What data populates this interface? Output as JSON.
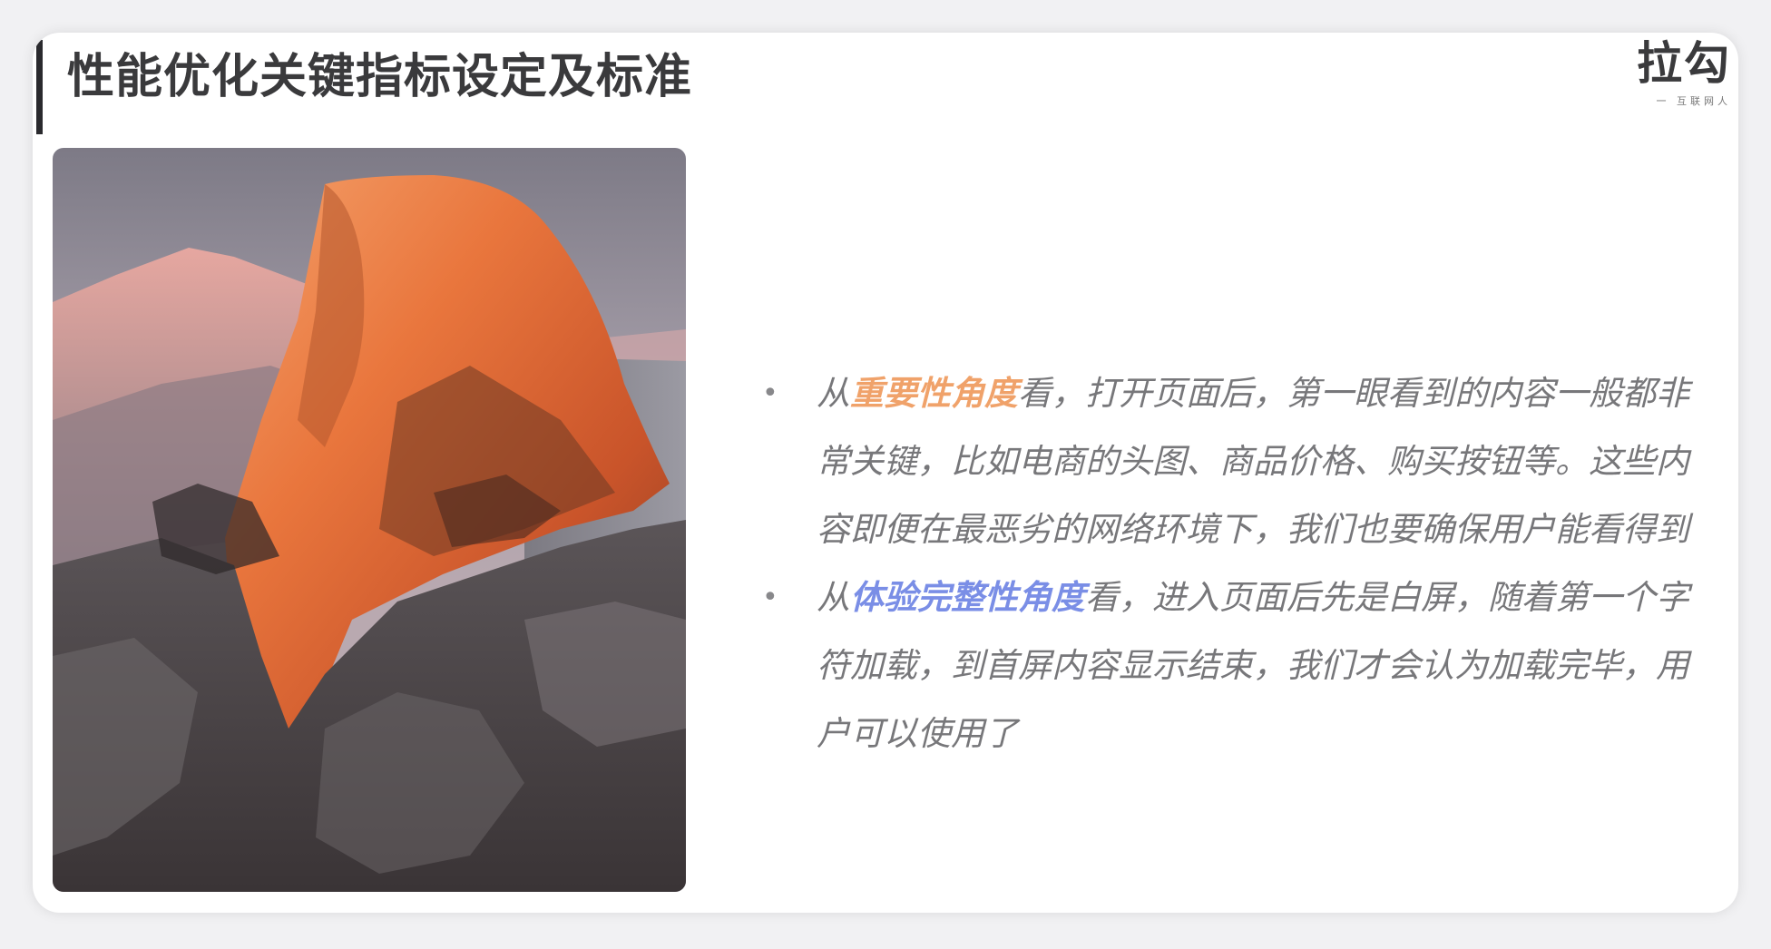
{
  "slide": {
    "title": "性能优化关键指标设定及标准",
    "logo": {
      "main": "拉勾",
      "sub": "一 互联网人"
    }
  },
  "photo": {
    "icon": "mountain-photo",
    "description_hidden": false
  },
  "bullets": [
    {
      "prefix": "从",
      "highlight": "重要性角度",
      "rest": "看，打开页面后，第一眼看到的内容一般都非常关键，比如电商的头图、商品价格、购买按钮等。这些内容即便在最恶劣的网络环境下，我们也要确保用户能看得到"
    },
    {
      "prefix": "从",
      "highlight": "体验完整性角度",
      "rest": "看，进入页面后先是白屏，随着第一个字符加载，到首屏内容显示结束，我们才会认为加载完毕，用户可以使用了"
    }
  ],
  "colors": {
    "highlight_orange": "#f0a26a",
    "highlight_blue": "#7a8ee6",
    "body_text": "#77777a",
    "title_text": "#3a3a3c"
  }
}
